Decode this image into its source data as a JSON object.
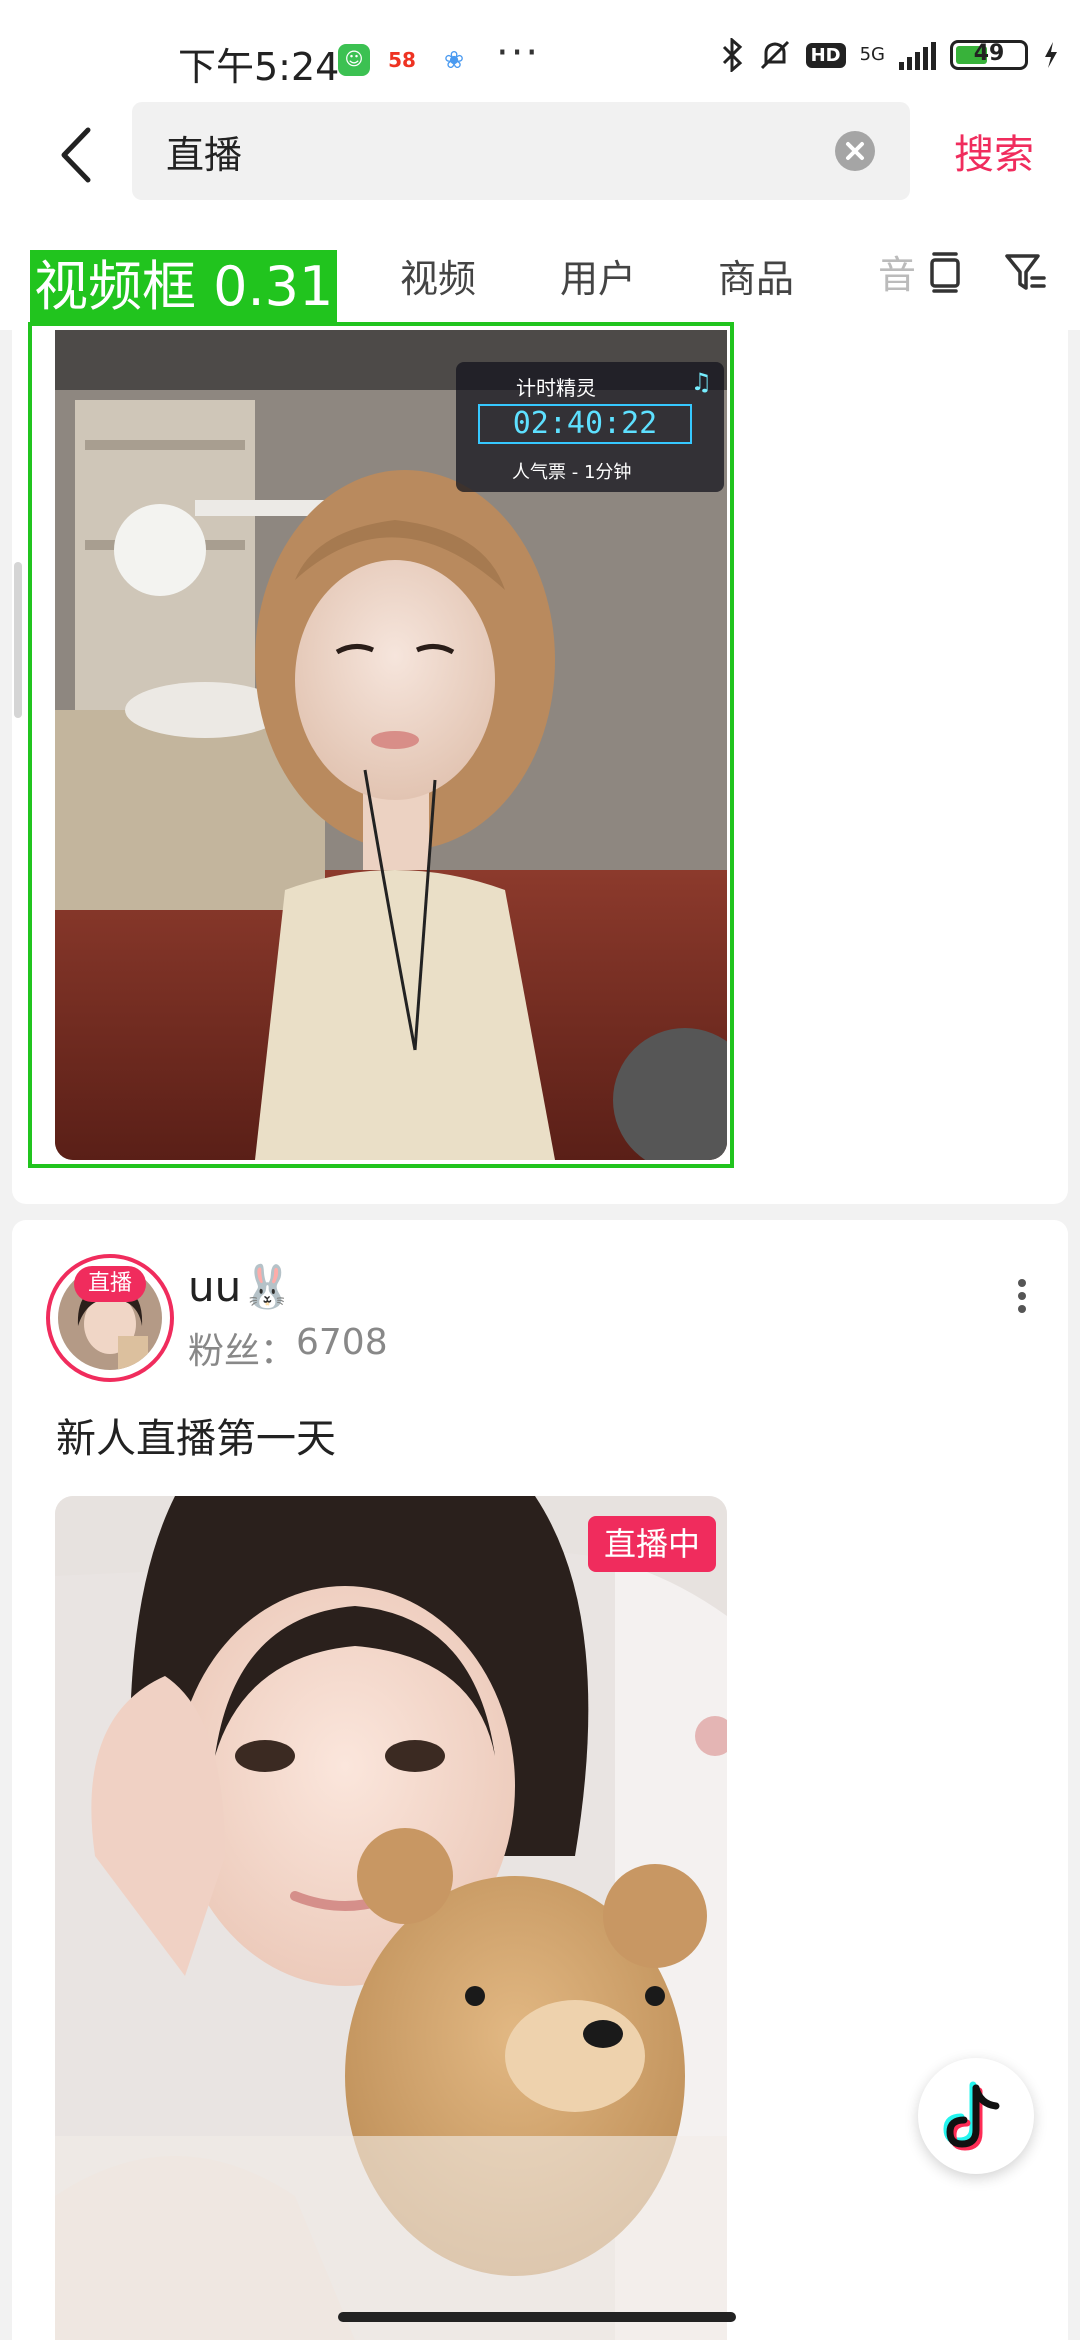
{
  "status_bar": {
    "time": "下午5:24",
    "badge_58": "58",
    "network": "5G",
    "hd": "HD",
    "battery": "49",
    "battery_level": 0.49
  },
  "search": {
    "query": "直播",
    "submit_label": "搜索"
  },
  "tabs": [
    "视频",
    "用户",
    "商品",
    "音"
  ],
  "detection": {
    "label": "视频框 0.31",
    "color": "#21c41e"
  },
  "card1": {
    "timer_title": "计时精灵",
    "timer_value": "02:40:22",
    "timer_sub": "人气票 - 1分钟"
  },
  "card2": {
    "avatar_badge": "直播",
    "username": "uu🐰",
    "followers_label": "粉丝：",
    "followers_value": "6708",
    "description": "新人直播第一天",
    "live_badge": "直播中"
  },
  "colors": {
    "accent": "#f02c5d"
  }
}
